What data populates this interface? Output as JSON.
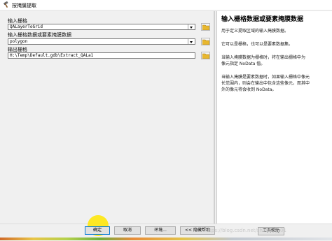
{
  "window": {
    "title": "按掩膜提取"
  },
  "form": {
    "input_raster": {
      "label": "输入栅格",
      "value": "QALayerToGrid"
    },
    "mask": {
      "label": "输入栅格数据或要素掩膜数据",
      "value": "polygon"
    },
    "output": {
      "label": "输出栅格",
      "value": "H:\\Temp\\Default.gdb\\Extract_QALa1"
    }
  },
  "help": {
    "title": "输入栅格数据或要素掩膜数据",
    "paragraphs": [
      "用于定义提取区域的输入掩膜数据。",
      "它可以是栅格，也可以是要素数据集。",
      "当输入掩膜数据为栅格时，将在输出栅格中为",
      "像元指定 NoData 值。",
      "当输入掩膜是要素数据时，如果输入栅格中像元",
      "长范围内，则会在输出中包含这些像元，而其中",
      "外的像元将会收到 NoData。"
    ]
  },
  "buttons": {
    "ok": "确定",
    "cancel": "取消",
    "environments": "环境...",
    "hide_help": "<< 隐藏帮助",
    "tool_help": "工具帮助"
  },
  "watermark": "https://blog.csdn.net/shanboy_01",
  "colors": {
    "ok_border": "#0078d7",
    "cursor_highlight": "#ffe600",
    "folder": "#e8b72e"
  }
}
